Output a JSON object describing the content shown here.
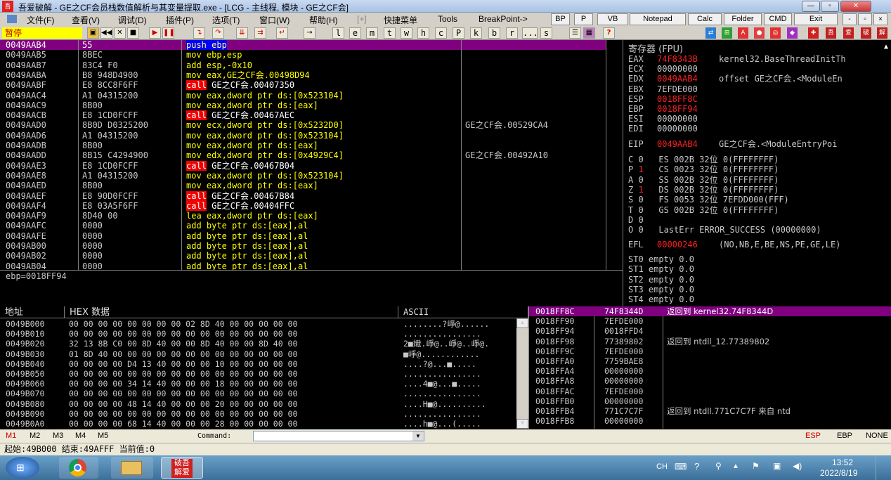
{
  "window": {
    "title": "吾爱破解 - GE之CF会员栈数值解析与其变量提取.exe - [LCG - 主线程, 模块 - GE之CF会]",
    "minimize": "0",
    "restore": "1",
    "close": "r"
  },
  "menu": [
    "文件(F)",
    "查看(V)",
    "调试(D)",
    "插件(P)",
    "选项(T)",
    "窗口(W)",
    "帮助(H)",
    "[+]",
    "快捷菜单",
    "Tools",
    "BreakPoint->"
  ],
  "quick_buttons": [
    "BP",
    "P",
    "VB",
    "Notepad",
    "Calc",
    "Folder",
    "CMD",
    "Exit"
  ],
  "mdi_buttons": [
    "-",
    "▫",
    "×"
  ],
  "toolbar": {
    "status": "暂停",
    "letters": [
      "l",
      "e",
      "m",
      "t",
      "w",
      "h",
      "c",
      "P",
      "k",
      "b",
      "r",
      "...",
      "s"
    ],
    "question": "?"
  },
  "cpu": [
    {
      "addr": "0049AAB4",
      "hex": "55",
      "dis": "push ebp",
      "cmt": ""
    },
    {
      "addr": "0049AAB5",
      "hex": "8BEC",
      "dis": "mov ebp,esp",
      "cmt": ""
    },
    {
      "addr": "0049AAB7",
      "hex": "83C4 F0",
      "dis": "add esp,-0x10",
      "cmt": ""
    },
    {
      "addr": "0049AABA",
      "hex": "B8 948D4900",
      "dis": "mov eax,GE之CF会.00498D94",
      "cmt": ""
    },
    {
      "addr": "0049AABF",
      "hex": "E8 8CC8F6FF",
      "dis": "call GE之CF会.00407350",
      "cmt": ""
    },
    {
      "addr": "0049AAC4",
      "hex": "A1 04315200",
      "dis": "mov eax,dword ptr ds:[0x523104]",
      "cmt": ""
    },
    {
      "addr": "0049AAC9",
      "hex": "8B00",
      "dis": "mov eax,dword ptr ds:[eax]",
      "cmt": ""
    },
    {
      "addr": "0049AACB",
      "hex": "E8 1CD0FCFF",
      "dis": "call GE之CF会.00467AEC",
      "cmt": ""
    },
    {
      "addr": "0049AAD0",
      "hex": "8B0D D0325200",
      "dis": "mov ecx,dword ptr ds:[0x5232D0]",
      "cmt": "GE之CF会.00529CA4"
    },
    {
      "addr": "0049AAD6",
      "hex": "A1 04315200",
      "dis": "mov eax,dword ptr ds:[0x523104]",
      "cmt": ""
    },
    {
      "addr": "0049AADB",
      "hex": "8B00",
      "dis": "mov eax,dword ptr ds:[eax]",
      "cmt": ""
    },
    {
      "addr": "0049AADD",
      "hex": "8B15 C4294900",
      "dis": "mov edx,dword ptr ds:[0x4929C4]",
      "cmt": "GE之CF会.00492A10"
    },
    {
      "addr": "0049AAE3",
      "hex": "E8 1CD0FCFF",
      "dis": "call GE之CF会.00467B04",
      "cmt": ""
    },
    {
      "addr": "0049AAE8",
      "hex": "A1 04315200",
      "dis": "mov eax,dword ptr ds:[0x523104]",
      "cmt": ""
    },
    {
      "addr": "0049AAED",
      "hex": "8B00",
      "dis": "mov eax,dword ptr ds:[eax]",
      "cmt": ""
    },
    {
      "addr": "0049AAEF",
      "hex": "E8 90D0FCFF",
      "dis": "call GE之CF会.00467B84",
      "cmt": ""
    },
    {
      "addr": "0049AAF4",
      "hex": "E8 03A5F6FF",
      "dis": "call GE之CF会.00404FFC",
      "cmt": ""
    },
    {
      "addr": "0049AAF9",
      "hex": "8D40 00",
      "dis": "lea eax,dword ptr ds:[eax]",
      "cmt": ""
    },
    {
      "addr": "0049AAFC",
      "hex": "0000",
      "dis": "add byte ptr ds:[eax],al",
      "cmt": ""
    },
    {
      "addr": "0049AAFE",
      "hex": "0000",
      "dis": "add byte ptr ds:[eax],al",
      "cmt": ""
    },
    {
      "addr": "0049AB00",
      "hex": "0000",
      "dis": "add byte ptr ds:[eax],al",
      "cmt": ""
    },
    {
      "addr": "0049AB02",
      "hex": "0000",
      "dis": "add byte ptr ds:[eax],al",
      "cmt": ""
    },
    {
      "addr": "0049AB04",
      "hex": "0000",
      "dis": "add byte ptr ds:[eax],al",
      "cmt": ""
    }
  ],
  "info_line": "ebp=0018FF94",
  "registers": {
    "header": "寄存器 (FPU)",
    "gp": [
      {
        "n": "EAX",
        "v": "74F8343B",
        "c": "kernel32.BaseThreadInitTh",
        "red": true
      },
      {
        "n": "ECX",
        "v": "00000000",
        "c": "",
        "red": false
      },
      {
        "n": "EDX",
        "v": "0049AAB4",
        "c": "offset GE之CF会.<ModuleEn",
        "red": true
      },
      {
        "n": "EBX",
        "v": "7EFDE000",
        "c": "",
        "red": false
      },
      {
        "n": "ESP",
        "v": "0018FF8C",
        "c": "",
        "red": true
      },
      {
        "n": "EBP",
        "v": "0018FF94",
        "c": "",
        "red": true
      },
      {
        "n": "ESI",
        "v": "00000000",
        "c": "",
        "red": false
      },
      {
        "n": "EDI",
        "v": "00000000",
        "c": "",
        "red": false
      }
    ],
    "eip": {
      "n": "EIP",
      "v": "0049AAB4",
      "c": "GE之CF会.<ModuleEntryPoi"
    },
    "flags": [
      {
        "f": "C",
        "b": "0",
        "seg": "ES",
        "sv": "002B",
        "bits": "32位",
        "base": "0(FFFFFFFF)",
        "red": false
      },
      {
        "f": "P",
        "b": "1",
        "seg": "CS",
        "sv": "0023",
        "bits": "32位",
        "base": "0(FFFFFFFF)",
        "red": true
      },
      {
        "f": "A",
        "b": "0",
        "seg": "SS",
        "sv": "002B",
        "bits": "32位",
        "base": "0(FFFFFFFF)",
        "red": false
      },
      {
        "f": "Z",
        "b": "1",
        "seg": "DS",
        "sv": "002B",
        "bits": "32位",
        "base": "0(FFFFFFFF)",
        "red": true
      },
      {
        "f": "S",
        "b": "0",
        "seg": "FS",
        "sv": "0053",
        "bits": "32位",
        "base": "7EFDD000(FFF)",
        "red": false
      },
      {
        "f": "T",
        "b": "0",
        "seg": "GS",
        "sv": "002B",
        "bits": "32位",
        "base": "0(FFFFFFFF)",
        "red": false
      },
      {
        "f": "D",
        "b": "0",
        "seg": "",
        "sv": "",
        "bits": "",
        "base": "",
        "red": false
      },
      {
        "f": "O",
        "b": "0",
        "seg": "LastErr",
        "sv": "ERROR_SUCCESS (00000000)",
        "bits": "",
        "base": "",
        "red": false
      }
    ],
    "efl": {
      "n": "EFL",
      "v": "00000246",
      "c": "(NO,NB,E,BE,NS,PE,GE,LE)"
    },
    "fpu": [
      "ST0 empty 0.0",
      "ST1 empty 0.0",
      "ST2 empty 0.0",
      "ST3 empty 0.0",
      "ST4 empty 0.0"
    ]
  },
  "dump": {
    "headers": {
      "addr": "地址",
      "hex": "HEX 数据",
      "ascii": "ASCII"
    },
    "rows": [
      {
        "a": "0049B000",
        "h": "00 00 00 00 00 00 00 00 02 8D 40 00 00 00 00 00",
        "s": "........?崢@......"
      },
      {
        "a": "0049B010",
        "h": "00 00 00 00 00 00 00 00 00 00 00 00 00 00 00 00",
        "s": "................"
      },
      {
        "a": "0049B020",
        "h": "32 13 8B C0 00 8D 40 00 00 8D 40 00 00 8D 40 00",
        "s": "2■嬂.崢@..崢@..崢@."
      },
      {
        "a": "0049B030",
        "h": "01 8D 40 00 00 00 00 00 00 00 00 00 00 00 00 00",
        "s": "■崢@............"
      },
      {
        "a": "0049B040",
        "h": "00 00 00 00 D4 13 40 00 00 00 10 00 00 00 00 00",
        "s": "....?@...■....."
      },
      {
        "a": "0049B050",
        "h": "00 00 00 00 00 00 00 00 00 00 00 00 00 00 00 00",
        "s": "................"
      },
      {
        "a": "0049B060",
        "h": "00 00 00 00 34 14 40 00 00 00 18 00 00 00 00 00",
        "s": "....4■@...■....."
      },
      {
        "a": "0049B070",
        "h": "00 00 00 00 00 00 00 00 00 00 00 00 00 00 00 00",
        "s": "................"
      },
      {
        "a": "0049B080",
        "h": "00 00 00 00 48 14 40 00 00 00 20 00 00 00 00 00",
        "s": "....H■@.........."
      },
      {
        "a": "0049B090",
        "h": "00 00 00 00 00 00 00 00 00 00 00 00 00 00 00 00",
        "s": "................"
      },
      {
        "a": "0049B0A0",
        "h": "00 00 00 00 68 14 40 00 00 00 28 00 00 00 00 00",
        "s": "....h■@...(....."
      }
    ]
  },
  "stack": [
    {
      "a": "0018FF8C",
      "v": "74F8344D",
      "c": "返回到 kernel32.74F8344D"
    },
    {
      "a": "0018FF90",
      "v": "7EFDE000",
      "c": ""
    },
    {
      "a": "0018FF94",
      "v": "0018FFD4",
      "c": ""
    },
    {
      "a": "0018FF98",
      "v": "77389802",
      "c": "返回到 ntdll_12.77389802"
    },
    {
      "a": "0018FF9C",
      "v": "7EFDE000",
      "c": ""
    },
    {
      "a": "0018FFA0",
      "v": "7759BAE8",
      "c": ""
    },
    {
      "a": "0018FFA4",
      "v": "00000000",
      "c": ""
    },
    {
      "a": "0018FFA8",
      "v": "00000000",
      "c": ""
    },
    {
      "a": "0018FFAC",
      "v": "7EFDE000",
      "c": ""
    },
    {
      "a": "0018FFB0",
      "v": "00000000",
      "c": ""
    },
    {
      "a": "0018FFB4",
      "v": "771C7C7F",
      "c": "返回到 ntdll.771C7C7F 来自 ntd"
    },
    {
      "a": "0018FFB8",
      "v": "00000000",
      "c": ""
    }
  ],
  "cmdbar": {
    "marks": [
      "M1",
      "M2",
      "M3",
      "M4",
      "M5"
    ],
    "label": "Command:",
    "regs": [
      "ESP",
      "EBP",
      "NONE"
    ]
  },
  "statusbar": "起始:49B000 结束:49AFFF 当前值:0",
  "taskbar": {
    "lang": "CH",
    "time": "13:52",
    "date": "2022/8/19",
    "app_label": "破吾\n解爱"
  },
  "colors": {
    "selected_row": "#800080",
    "disasm_text": "#ffff00",
    "call_bg": "#f00000",
    "changed_reg": "#ff2020",
    "paused_bg": "#ffff00"
  }
}
